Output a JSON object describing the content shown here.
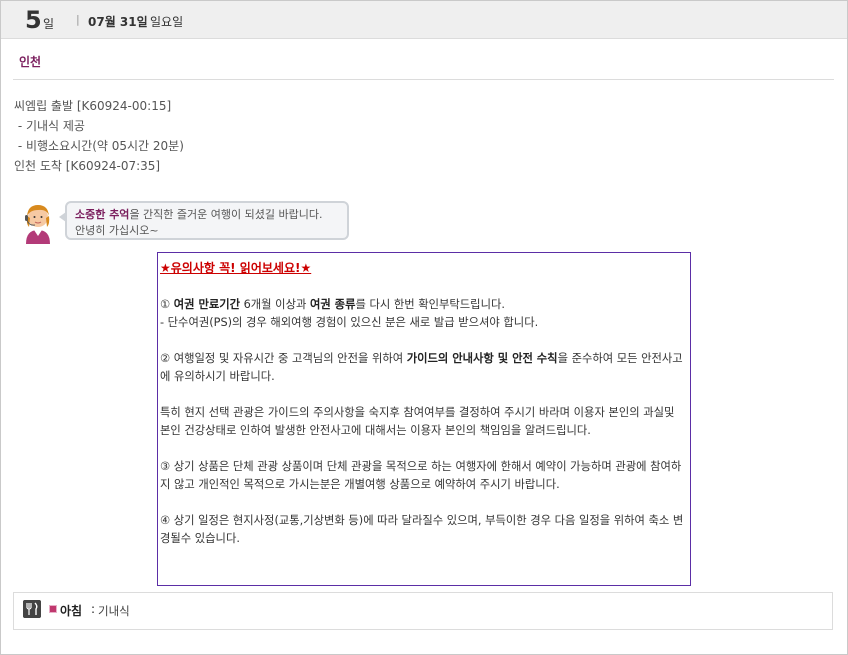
{
  "day": {
    "number": "5",
    "unit": "일",
    "separator": "|",
    "date": "07월 31일",
    "weekday": "일요일"
  },
  "city": "인천",
  "flight": {
    "lines": [
      "씨엠립 출발 [K60924-00:15]",
      " - 기내식 제공",
      " - 비행소요시간(약 05시간 20분)",
      "인천 도착 [K60924-07:35]"
    ]
  },
  "bubble": {
    "highlight": "소중한 추억",
    "line1_rest": "을 간직한 즐거운 여행이 되셨길 바랍니다.",
    "line2": "안녕히 가십시오~"
  },
  "notice": {
    "title": "★유의사항 꼭! 읽어보세요!★",
    "p1_a": "① ",
    "p1_b": "여권 만료기간",
    "p1_c": " 6개월 이상과 ",
    "p1_d": "여권 종류",
    "p1_e": "를 다시 한번 확인부탁드립니다.",
    "p1_line2": "- 단수여권(PS)의 경우 해외여행 경험이 있으신 분은 새로 발급 받으셔야 합니다.",
    "p2_a": "② 여행일정 및 자유시간 중 고객님의 안전을 위하여 ",
    "p2_b": "가이드의 안내사항 및 안전 수칙",
    "p2_c": "을 준수하여 모든 안전사고에 유의하시기 바랍니다.",
    "p3": "특히 현지 선택 관광은 가이드의 주의사항을 숙지후 참여여부를 결정하여 주시기 바라며 이용자 본인의 과실및 본인 건강상태로 인하여 발생한 안전사고에 대해서는 이용자 본인의 책임임을 알려드립니다.",
    "p4": "③ 상기 상품은 단체 관광 상품이며 단체 관광을 목적으로 하는 여행자에 한해서 예약이 가능하며 관광에 참여하지 않고 개인적인 목적으로 가시는분은 개별여행 상품으로 예약하여 주시기 바랍니다.",
    "p5": "④ 상기 일정은 현지사정(교통,기상변화 등)에 따라 달라질수 있으며, 부득이한 경우 다음 일정을 위하여 축소 변경될수 있습니다."
  },
  "meal": {
    "icon": "fork-knife-icon",
    "label": "아침",
    "colon": ":",
    "value": "기내식"
  },
  "colors": {
    "accent": "#7b1f5e",
    "notice_border": "#5b2ea6",
    "notice_title": "#cc0000"
  }
}
